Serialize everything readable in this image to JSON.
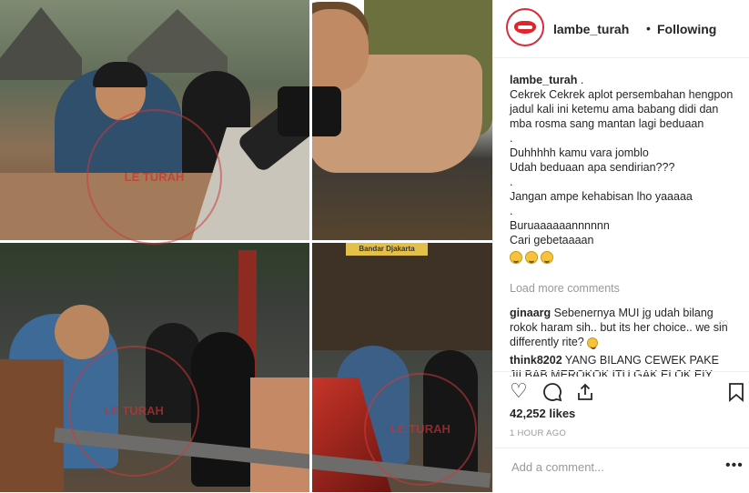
{
  "header": {
    "username": "lambe_turah",
    "separator": "•",
    "follow_status": "Following"
  },
  "caption": {
    "username": "lambe_turah",
    "first": " .",
    "lines": [
      "Cekrek Cekrek aplot persembahan hengpon jadul kali ini ketemu ama babang didi dan mba rosma sang mantan lagi beduaan",
      ".",
      "Duhhhhh kamu vara jomblo",
      "Udah beduaan apa sendirian???",
      ".",
      "Jangan ampe kehabisan lho yaaaaa",
      ".",
      "Buruaaaaaannnnnn",
      "Cari gebetaaaan"
    ],
    "emojis": [
      "grinning-face",
      "grinning-face",
      "grinning-face"
    ]
  },
  "load_more": "Load more comments",
  "comments": [
    {
      "username": "ginaarg",
      "text": " Sebenernya MUI jg udah bilang rokok haram sih.. but its her choice.. we sin differently rite?"
    },
    {
      "username": "think8202",
      "text": " YANG BILANG CEWEK PAKE JILBAB MEROKOK ITU GAK ELOK EIY"
    }
  ],
  "photo": {
    "watermark": "LE TURAH",
    "sign": "Bandar Djakarta"
  },
  "likes": "42,252 likes",
  "timestamp": "1 HOUR AGO",
  "add_comment_placeholder": "Add a comment...",
  "icons": {
    "like": "heart-icon",
    "comment": "comment-icon",
    "share": "share-icon",
    "save": "bookmark-icon",
    "more": "more-options-icon"
  },
  "colors": {
    "avatar_ring": "#d62d3a",
    "text": "#262626",
    "muted": "#999999"
  }
}
